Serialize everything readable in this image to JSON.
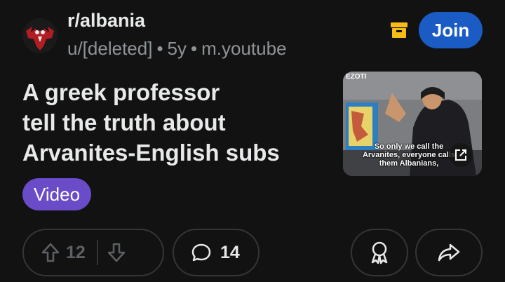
{
  "post": {
    "subreddit": "r/albania",
    "author": "u/[deleted]",
    "age": "5y",
    "domain": "m.youtube",
    "separator": "•",
    "title_lines": [
      "A greek professor",
      "tell the truth about",
      "Arvanites-English subs"
    ],
    "flair": "Video"
  },
  "header": {
    "join_label": "Join"
  },
  "thumbnail": {
    "channel_label": "EZOTI",
    "caption": "So only we call the Arvanites, everyone calls them Albanians,"
  },
  "actions": {
    "upvotes": "12",
    "comments": "14"
  },
  "colors": {
    "background": "#121212",
    "join": "#1a5bc4",
    "flair": "#6a4bc8",
    "archive": "#f5bd16"
  },
  "icons": {
    "avatar": "albania-eagle-avatar",
    "archive": "archive-icon",
    "upvote": "upvote-arrow-icon",
    "downvote": "downvote-arrow-icon",
    "comment": "comment-bubble-icon",
    "award": "award-ribbon-icon",
    "share": "share-arrow-icon",
    "external": "external-link-icon"
  }
}
